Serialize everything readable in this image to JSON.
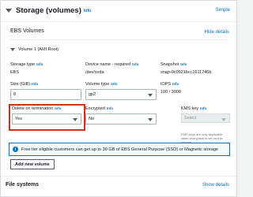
{
  "storage": {
    "title": "Storage (volumes)",
    "info": "Info",
    "simple_link": "Simple"
  },
  "ebs": {
    "title": "EBS Volumes",
    "hide_details": "Hide details"
  },
  "volume": {
    "header": "Volume 1 (AMI Root)",
    "storage_type": {
      "label": "Storage type",
      "info": "Info",
      "value": "EBS"
    },
    "device_name": {
      "label": "Device name - required",
      "info": "Info",
      "value": "/dev/xvda"
    },
    "snapshot": {
      "label": "Snapshot",
      "info": "Info",
      "value": "snap-0c0921bcc1611746b"
    },
    "size": {
      "label": "Size (GiB)",
      "info": "Info",
      "value": "8"
    },
    "volume_type": {
      "label": "Volume type",
      "info": "Info",
      "value": "gp2"
    },
    "iops": {
      "label": "IOPS",
      "info": "Info",
      "value": "100 / 3000"
    },
    "delete_on_termination": {
      "label": "Delete on termination",
      "info": "Info",
      "value": "Yes"
    },
    "encrypted": {
      "label": "Encrypted",
      "info": "Info",
      "value": "No"
    },
    "kms_key": {
      "label": "KMS key",
      "info": "Info",
      "placeholder": "Select",
      "note": "EMS keys are only applicable when encryption is set on this volume."
    }
  },
  "free_tier_banner": {
    "icon": "info-icon",
    "text": "Free tier eligible customers can get up to 30 GB of EBS General Purpose (SSD) or Magnetic storage"
  },
  "add_volume_button": "Add new volume",
  "file_systems": {
    "title": "File systems",
    "show_details": "Show details"
  },
  "colors": {
    "link": "#0073bb",
    "highlight": "#d13212",
    "banner_bg": "#f1faff"
  }
}
